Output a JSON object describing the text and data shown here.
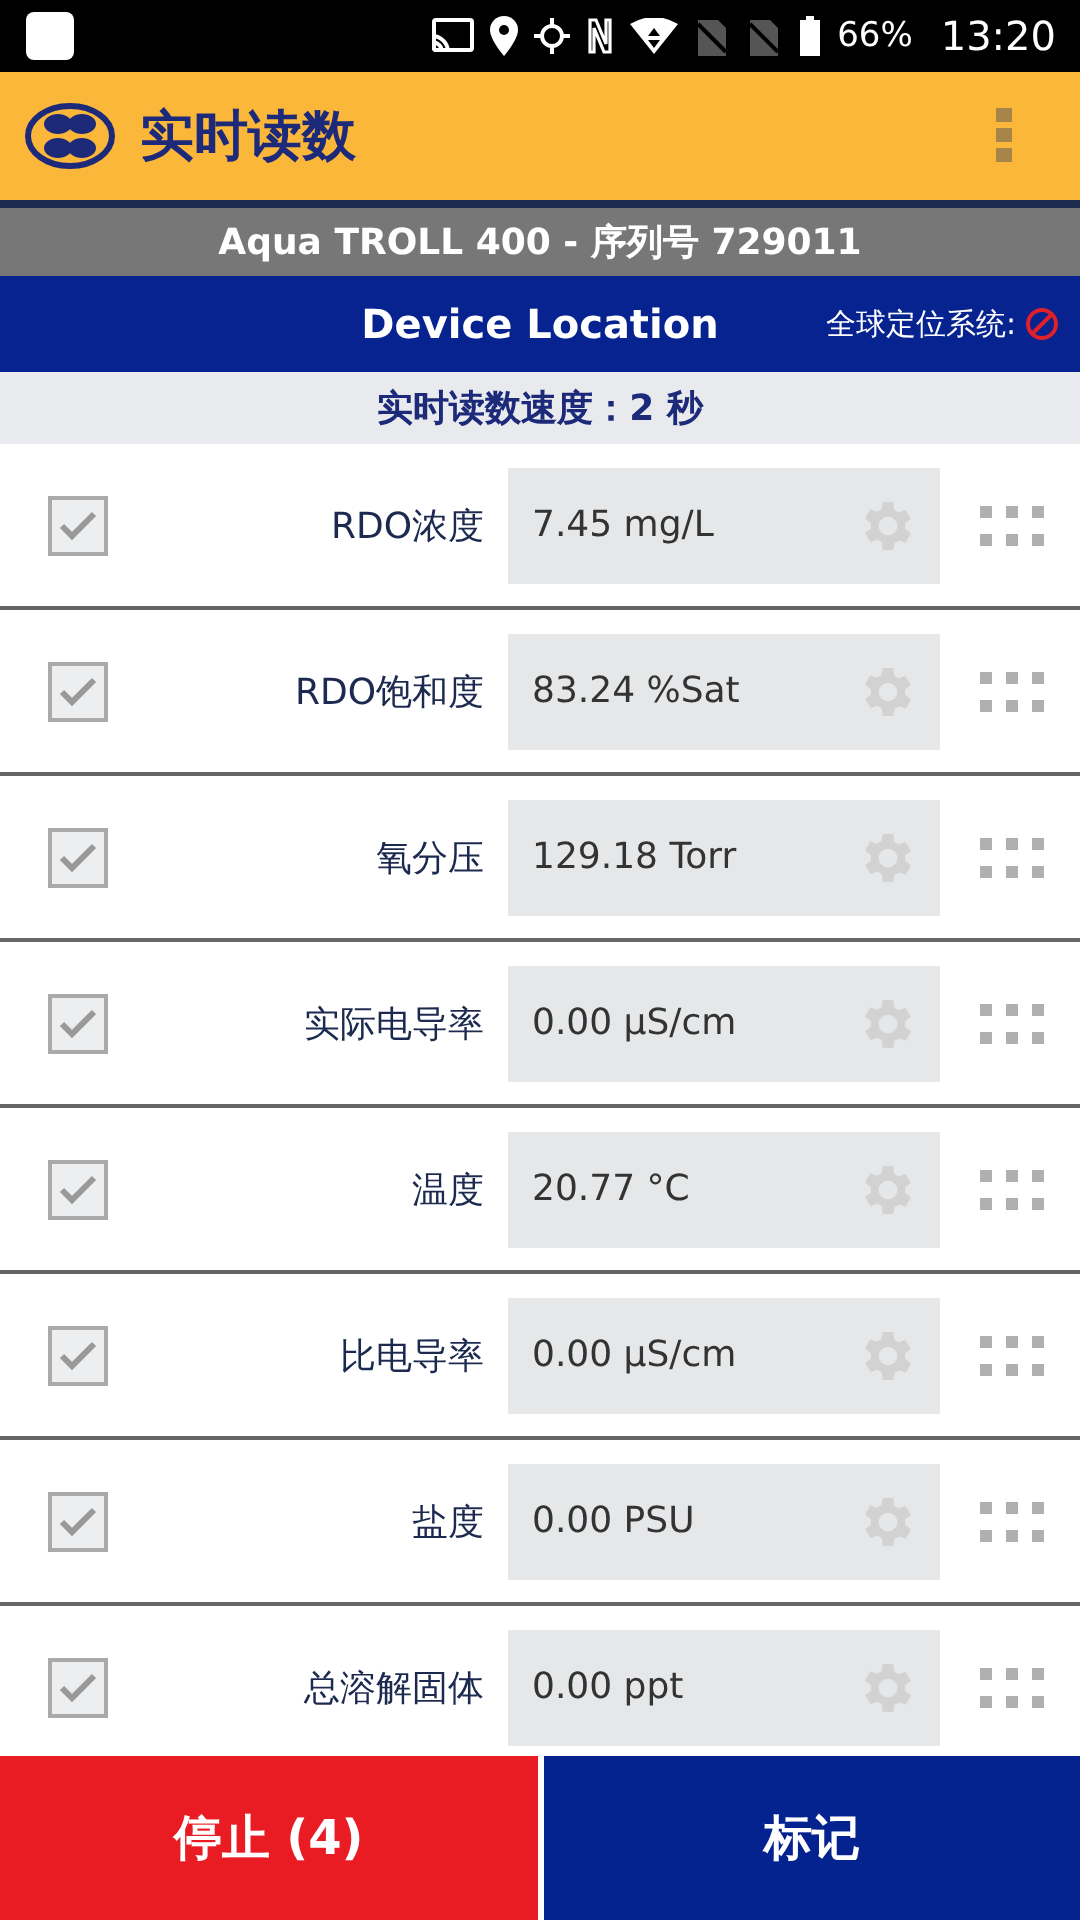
{
  "status_bar": {
    "battery": "66%",
    "time": "13:20"
  },
  "app_bar": {
    "title": "实时读数"
  },
  "device_bar": {
    "title": "Aqua TROLL 400 - 序列号 729011"
  },
  "location_bar": {
    "title": "Device Location",
    "gps_label": "全球定位系统:"
  },
  "speed_bar": {
    "text": "实时读数速度：2 秒"
  },
  "readings": [
    {
      "name": "RDO浓度",
      "value": "7.45 mg/L",
      "checked": true
    },
    {
      "name": "RDO饱和度",
      "value": "83.24 %Sat",
      "checked": true
    },
    {
      "name": "氧分压",
      "value": "129.18 Torr",
      "checked": true
    },
    {
      "name": "实际电导率",
      "value": "0.00 µS/cm",
      "checked": true
    },
    {
      "name": "温度",
      "value": "20.77 °C",
      "checked": true
    },
    {
      "name": "比电导率",
      "value": "0.00 µS/cm",
      "checked": true
    },
    {
      "name": "盐度",
      "value": "0.00 PSU",
      "checked": true
    },
    {
      "name": "总溶解固体",
      "value": "0.00 ppt",
      "checked": true
    }
  ],
  "buttons": [
    {
      "label": "停止 (4)",
      "kind": "stop"
    },
    {
      "label": "标记",
      "kind": "mark"
    }
  ]
}
